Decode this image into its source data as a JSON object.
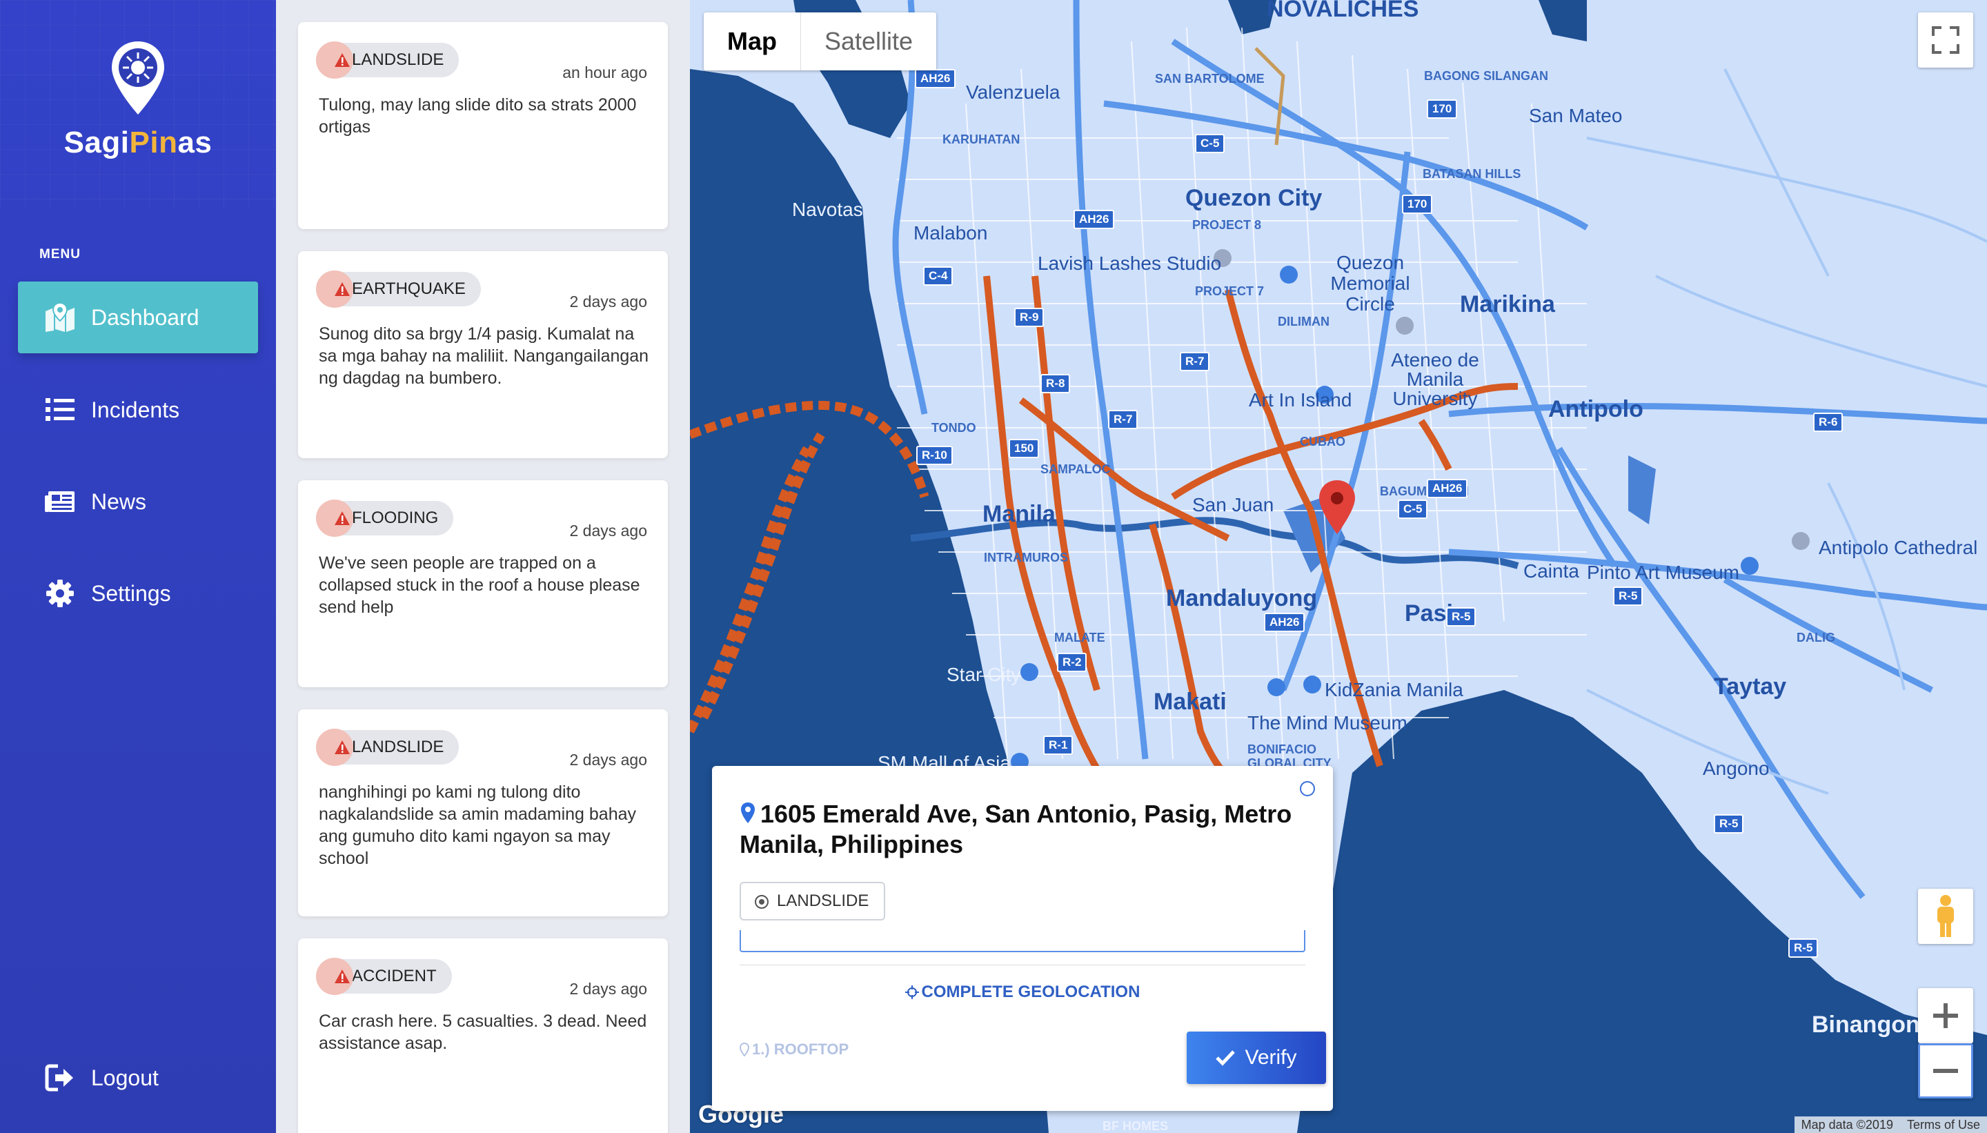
{
  "brand": {
    "part1": "Sagi",
    "part2": "Pin",
    "part3": "as"
  },
  "menu": {
    "label": "MENU",
    "items": [
      {
        "label": "Dashboard",
        "icon": "map-marker-icon",
        "active": true
      },
      {
        "label": "Incidents",
        "icon": "list-icon"
      },
      {
        "label": "News",
        "icon": "newspaper-icon"
      },
      {
        "label": "Settings",
        "icon": "gear-icon"
      }
    ],
    "logout": "Logout"
  },
  "feed": [
    {
      "tag": "LANDSLIDE",
      "time": "an hour ago",
      "message": "Tulong, may lang slide dito sa strats 2000 ortigas"
    },
    {
      "tag": "EARTHQUAKE",
      "time": "2 days ago",
      "message": "Sunog dito sa brgy 1/4 pasig. Kumalat na sa mga bahay na maliliit. Nangangailangan ng dagdag na bumbero."
    },
    {
      "tag": "FLOODING",
      "time": "2 days ago",
      "message": "We've seen people are trapped on a collapsed stuck in the roof a house please send help"
    },
    {
      "tag": "LANDSLIDE",
      "time": "2 days ago",
      "message": "nanghihingi po kami ng tulong dito nagkalandslide sa amin madaming bahay ang gumuho dito kami ngayon sa may school"
    },
    {
      "tag": "ACCIDENT",
      "time": "2 days ago",
      "message": "Car crash here. 5 casualties. 3 dead. Need assistance asap."
    }
  ],
  "map": {
    "type_map": "Map",
    "type_satellite": "Satellite",
    "attribution": "Map data ©2019",
    "terms": "Terms of Use",
    "google": "Google",
    "labels": {
      "novaliches": "NOVALICHES",
      "valenzuela": "Valenzuela",
      "san_bartolome": "SAN BARTOLOME",
      "bagong_silangan": "BAGONG SILANGAN",
      "san_mateo": "San Mateo",
      "karuhatan": "KARUHATAN",
      "batasan_hills": "BATASAN HILLS",
      "navotas": "Navotas",
      "malabon": "Malabon",
      "quezon_city": "Quezon City",
      "project_8": "PROJECT 8",
      "lavish": "Lavish Lashes Studio",
      "quezon_memorial": "Quezon Memorial Circle",
      "project_7": "PROJECT 7",
      "diliman": "DILIMAN",
      "marikina": "Marikina",
      "ateneo": "Ateneo de Manila University",
      "art_in_island": "Art In Island",
      "antipolo": "Antipolo",
      "tondo": "TONDO",
      "cubao": "CUBAO",
      "sampaloc": "SAMPALOC",
      "manila": "Manila",
      "san_juan": "San Juan",
      "bagumbayan": "BAGUMBAYAN",
      "intramuros": "INTRAMUROS",
      "mandaluyong": "Mandaluyong",
      "pasig": "Pasig",
      "cainta": "Cainta",
      "pinto": "Pinto Art Museum",
      "antipolo_cathedral": "Antipolo Cathedral",
      "malate": "MALATE",
      "star_city": "Star City",
      "dalig": "DALIG",
      "taytay": "Taytay",
      "makati": "Makati",
      "kidzania": "KidZania Manila",
      "mind_museum": "The Mind Museum",
      "bonifacio": "BONIFACIO GLOBAL CITY",
      "sm_mall": "SM Mall of Asia",
      "angono": "Angono",
      "binangonan": "Binangonan",
      "bf_homes": "BF HOMES"
    },
    "shields": {
      "ah26_a": "AH26",
      "ah26_b": "AH26",
      "ah26_c": "AH26",
      "ah26_d": "AH26",
      "c5_a": "C-5",
      "c5_b": "C-5",
      "c4": "C-4",
      "r9": "R-9",
      "r8": "R-8",
      "r7_a": "R-7",
      "r7_b": "R-7",
      "r10": "R-10",
      "r2": "R-2",
      "r1": "R-1",
      "r5_a": "R-5",
      "r5_b": "R-5",
      "r5_c": "R-5",
      "r5_d": "R-5",
      "r6": "R-6",
      "n150": "150",
      "n170_a": "170",
      "n170_b": "170"
    }
  },
  "popup": {
    "address": "1605 Emerald Ave, San Antonio, Pasig, Metro Manila, Philippines",
    "tag": "LANDSLIDE",
    "geo_link": "COMPLETE GEOLOCATION",
    "precision": "1.) ROOFTOP",
    "verify": "Verify"
  },
  "colors": {
    "sidebar": "#3342c9",
    "active_nav": "#52c0cc",
    "brand_accent": "#f2b53b",
    "alert": "#d93b30",
    "map_water": "#1d4f91",
    "map_land": "#cfe0fb",
    "traffic": "#d65a22",
    "verify": "#2f5fd4"
  }
}
